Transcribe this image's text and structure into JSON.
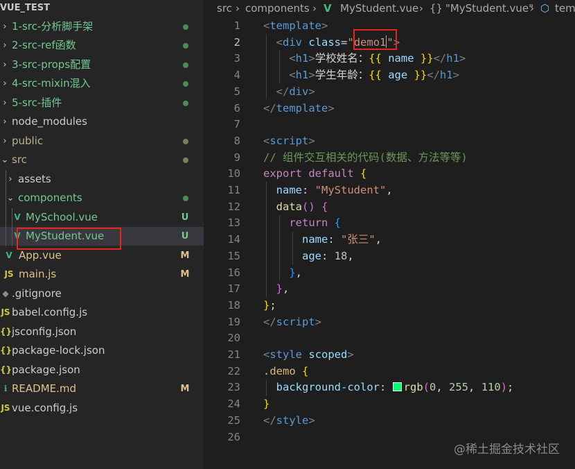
{
  "explorer": {
    "project_title": "VUE_TEST",
    "items": [
      {
        "chevron": "›",
        "icon": "",
        "label": "1-src-分析脚手架",
        "deco": "dot",
        "color": "green"
      },
      {
        "chevron": "›",
        "icon": "",
        "label": "2-src-ref函数",
        "deco": "dot",
        "color": "green"
      },
      {
        "chevron": "›",
        "icon": "",
        "label": "3-src-props配置",
        "deco": "dot",
        "color": "green"
      },
      {
        "chevron": "›",
        "icon": "",
        "label": "4-src-mixin混入",
        "deco": "dot",
        "color": "green"
      },
      {
        "chevron": "›",
        "icon": "",
        "label": "5-src-插件",
        "deco": "dot",
        "color": "green"
      },
      {
        "chevron": "›",
        "icon": "",
        "label": "node_modules",
        "deco": "",
        "color": "grey"
      },
      {
        "chevron": "›",
        "icon": "",
        "label": "public",
        "deco": "dot",
        "color": "olive"
      },
      {
        "chevron": "⌄",
        "icon": "",
        "label": "src",
        "deco": "dot",
        "color": "olive"
      },
      {
        "chevron": "›",
        "icon": "",
        "label": "assets",
        "deco": "",
        "color": "grey"
      },
      {
        "chevron": "⌄",
        "icon": "",
        "label": "components",
        "deco": "dot",
        "color": "green"
      },
      {
        "chevron": "",
        "icon": "vue-icon",
        "label": "MySchool.vue",
        "deco": "U",
        "color": "green"
      },
      {
        "chevron": "",
        "icon": "vue-icon",
        "label": "MyStudent.vue",
        "deco": "U",
        "color": "green"
      },
      {
        "chevron": "",
        "icon": "vue-icon",
        "label": "App.vue",
        "deco": "M",
        "color": "mod"
      },
      {
        "chevron": "",
        "icon": "js-icon",
        "label": "main.js",
        "deco": "M",
        "color": "mod"
      },
      {
        "chevron": "",
        "icon": "git-icon",
        "label": ".gitignore",
        "deco": "",
        "color": "grey"
      },
      {
        "chevron": "",
        "icon": "js-icon",
        "label": "babel.config.js",
        "deco": "",
        "color": "grey"
      },
      {
        "chevron": "",
        "icon": "json-icon",
        "label": "jsconfig.json",
        "deco": "",
        "color": "grey"
      },
      {
        "chevron": "",
        "icon": "json-icon",
        "label": "package-lock.json",
        "deco": "",
        "color": "grey"
      },
      {
        "chevron": "",
        "icon": "json-icon",
        "label": "package.json",
        "deco": "",
        "color": "grey"
      },
      {
        "chevron": "",
        "icon": "md-icon",
        "label": "README.md",
        "deco": "M",
        "color": "mod"
      },
      {
        "chevron": "",
        "icon": "js-icon",
        "label": "vue.config.js",
        "deco": "",
        "color": "grey"
      }
    ]
  },
  "breadcrumb": {
    "part1": "src",
    "part2": "components",
    "part3": "MyStudent.vue",
    "part4": "\"MyStudent.vue\"",
    "part5": "tem",
    "sep": "›",
    "braces": "{}"
  },
  "code": {
    "line_numbers": [
      "1",
      "2",
      "3",
      "4",
      "5",
      "6",
      "7",
      "8",
      "9",
      "10",
      "11",
      "12",
      "13",
      "14",
      "15",
      "16",
      "17",
      "18",
      "19",
      "20",
      "21",
      "22",
      "23",
      "24",
      "25",
      "26"
    ],
    "active_line": "2",
    "l1_tag": "template",
    "l2_tag": "div",
    "l2_attr": "class",
    "l2_value": "demo1",
    "l3_tag": "h1",
    "l3_text": "学校姓名：",
    "l3_expr": "name",
    "l4_tag": "h1",
    "l4_text": "学生年龄：",
    "l4_expr": "age",
    "l5_tag": "div",
    "l6_tag": "template",
    "l8_tag": "script",
    "l9_comment": "// 组件交互相关的代码(数据、方法等等)",
    "l10_kw1": "export",
    "l10_kw2": "default",
    "l11_key": "name",
    "l11_val": "\"MyStudent\"",
    "l12_func": "data",
    "l13_kw": "return",
    "l14_key": "name",
    "l14_val": "\"张三\"",
    "l15_key": "age",
    "l15_val": "18",
    "l19_tag": "script",
    "l21_tag": "style",
    "l21_attr": "scoped",
    "l22_selector": ".demo",
    "l23_prop": "background-color",
    "l23_func": "rgb",
    "l23_n1": "0",
    "l23_n2": "255",
    "l23_n3": "110",
    "l25_tag": "style",
    "swatch_color": "#00ff6e"
  },
  "watermark": "@稀土掘金技术社区"
}
